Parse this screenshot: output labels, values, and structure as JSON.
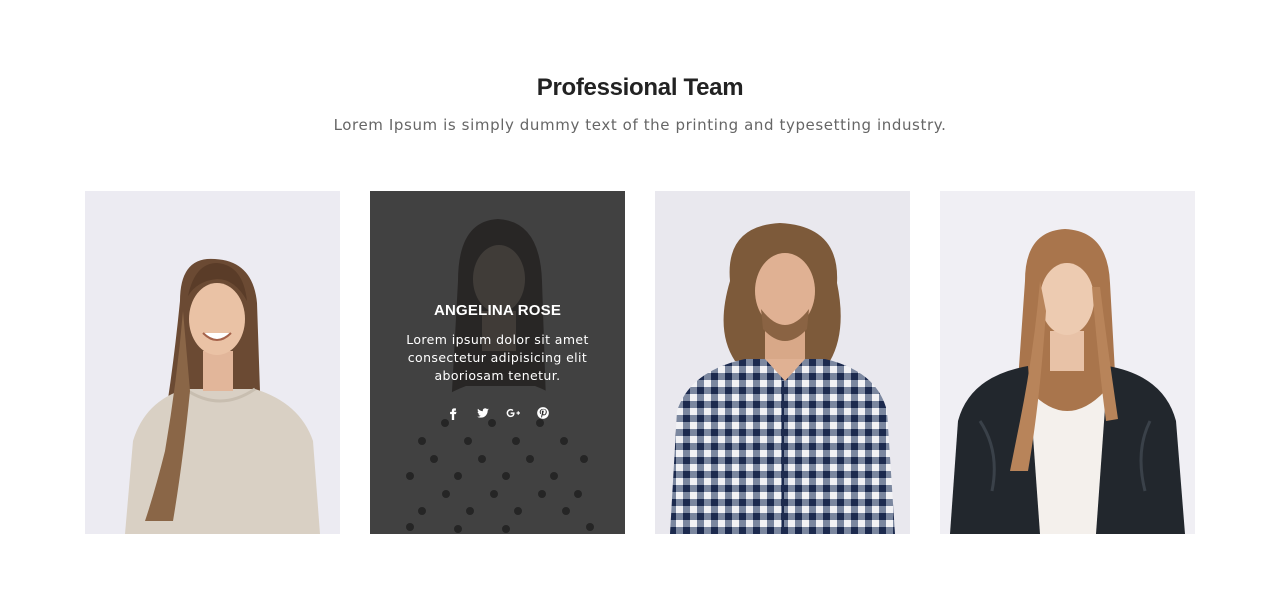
{
  "section": {
    "title": "Professional Team",
    "subtitle": "Lorem Ipsum is simply dummy text of the printing and typesetting industry."
  },
  "team": [
    {
      "id": "member-1",
      "photo": "woman smiling, beige sweater"
    },
    {
      "id": "member-2",
      "photo": "woman with polka dot shirt",
      "name": "ANGELINA ROSE",
      "bio": "Lorem ipsum dolor sit amet consectetur adipisicing elit aboriosam tenetur.",
      "social": [
        "facebook-icon",
        "twitter-icon",
        "google-plus-icon",
        "pinterest-icon"
      ]
    },
    {
      "id": "member-3",
      "photo": "man with curly hair, checkered shirt"
    },
    {
      "id": "member-4",
      "photo": "woman in leather jacket"
    }
  ],
  "colors": {
    "overlay": "#2b2b2b",
    "title": "#222222",
    "subtitle": "#666666"
  }
}
